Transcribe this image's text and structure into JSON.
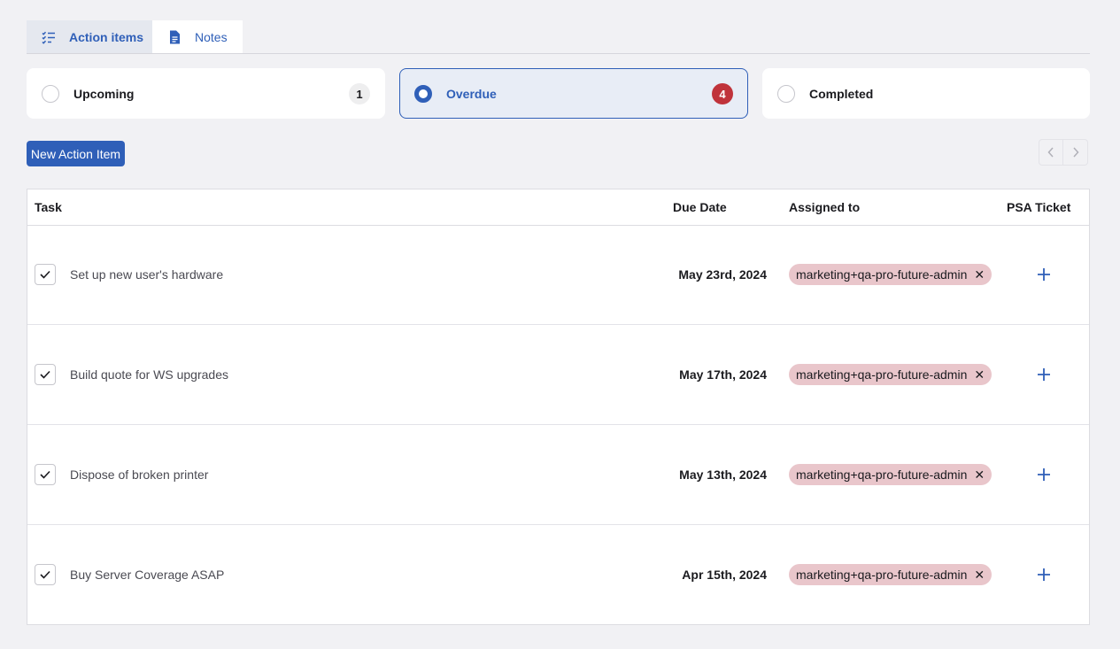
{
  "tabs": {
    "action_items": {
      "label": "Action items",
      "icon": "task-list-icon"
    },
    "notes": {
      "label": "Notes",
      "icon": "document-icon"
    }
  },
  "filters": [
    {
      "label": "Upcoming",
      "count": "1",
      "selected": false
    },
    {
      "label": "Overdue",
      "count": "4",
      "selected": true
    },
    {
      "label": "Completed",
      "count": "",
      "selected": false
    }
  ],
  "toolbar": {
    "new_label": "New Action Item",
    "prev_icon": "chevron-left-icon",
    "next_icon": "chevron-right-icon"
  },
  "table": {
    "headers": {
      "task": "Task",
      "due": "Due Date",
      "assigned": "Assigned to",
      "psa": "PSA Ticket"
    },
    "rows": [
      {
        "task": "Set up new user's hardware",
        "due": "May 23rd, 2024",
        "assignee": "marketing+qa-pro-future-admin"
      },
      {
        "task": "Build quote for WS upgrades",
        "due": "May 17th, 2024",
        "assignee": "marketing+qa-pro-future-admin"
      },
      {
        "task": "Dispose of broken printer",
        "due": "May 13th, 2024",
        "assignee": "marketing+qa-pro-future-admin"
      },
      {
        "task": "Buy Server Coverage ASAP",
        "due": "Apr 15th, 2024",
        "assignee": "marketing+qa-pro-future-admin"
      }
    ]
  },
  "colors": {
    "accent": "#2f5fb8",
    "alert": "#c0333b",
    "chip": "#e9c6cb",
    "background": "#f1f1f4"
  }
}
